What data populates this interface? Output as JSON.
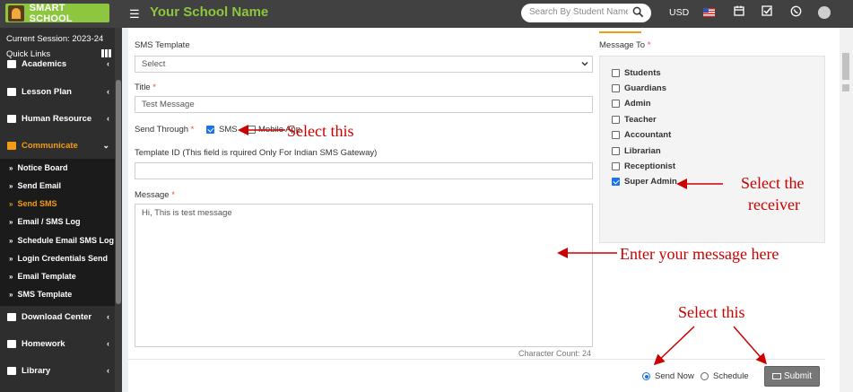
{
  "header": {
    "logo_text": "SMART SCHOOL",
    "school_name": "Your School Name",
    "search_placeholder": "Search By Student Name",
    "currency": "USD"
  },
  "sidebar": {
    "session": "Current Session: 2023-24",
    "quick_links": "Quick Links",
    "items": [
      {
        "label": "Academics"
      },
      {
        "label": "Lesson Plan"
      },
      {
        "label": "Human Resource"
      },
      {
        "label": "Communicate"
      },
      {
        "label": "Download Center"
      },
      {
        "label": "Homework"
      },
      {
        "label": "Library"
      }
    ],
    "submenu": [
      {
        "label": "Notice Board"
      },
      {
        "label": "Send Email"
      },
      {
        "label": "Send SMS"
      },
      {
        "label": "Email / SMS Log"
      },
      {
        "label": "Schedule Email SMS Log"
      },
      {
        "label": "Login Credentials Send"
      },
      {
        "label": "Email Template"
      },
      {
        "label": "SMS Template"
      }
    ]
  },
  "form": {
    "sms_template_label": "SMS Template",
    "sms_template_value": "Select",
    "title_label": "Title",
    "title_value": "Test Message",
    "send_through_label": "Send Through",
    "sms_label": "SMS",
    "mobile_app_label": "Mobile App",
    "template_id_label": "Template ID",
    "template_id_note": "(This field is rquired Only For Indian SMS Gateway)",
    "template_id_value": "",
    "message_label": "Message",
    "message_value": "Hi, This is test message",
    "char_count": "Character Count: 24",
    "required_mark": "*"
  },
  "message_to": {
    "label": "Message To",
    "options": [
      {
        "label": "Students",
        "checked": false
      },
      {
        "label": "Guardians",
        "checked": false
      },
      {
        "label": "Admin",
        "checked": false
      },
      {
        "label": "Teacher",
        "checked": false
      },
      {
        "label": "Accountant",
        "checked": false
      },
      {
        "label": "Librarian",
        "checked": false
      },
      {
        "label": "Receptionist",
        "checked": false
      },
      {
        "label": "Super Admin",
        "checked": true
      }
    ]
  },
  "footer": {
    "send_now_label": "Send Now",
    "schedule_label": "Schedule",
    "submit_label": "Submit",
    "send_mode": "Send Now"
  },
  "annotations": {
    "select_this_sms": "Select this",
    "select_receiver_line1": "Select the",
    "select_receiver_line2": "receiver",
    "enter_message": "Enter your message here",
    "select_this_bottom": "Select this"
  },
  "colors": {
    "accent": "#8dc63f",
    "active_menu": "#f39c12",
    "annotation": "#cc0000",
    "checkbox": "#1a73e8"
  }
}
